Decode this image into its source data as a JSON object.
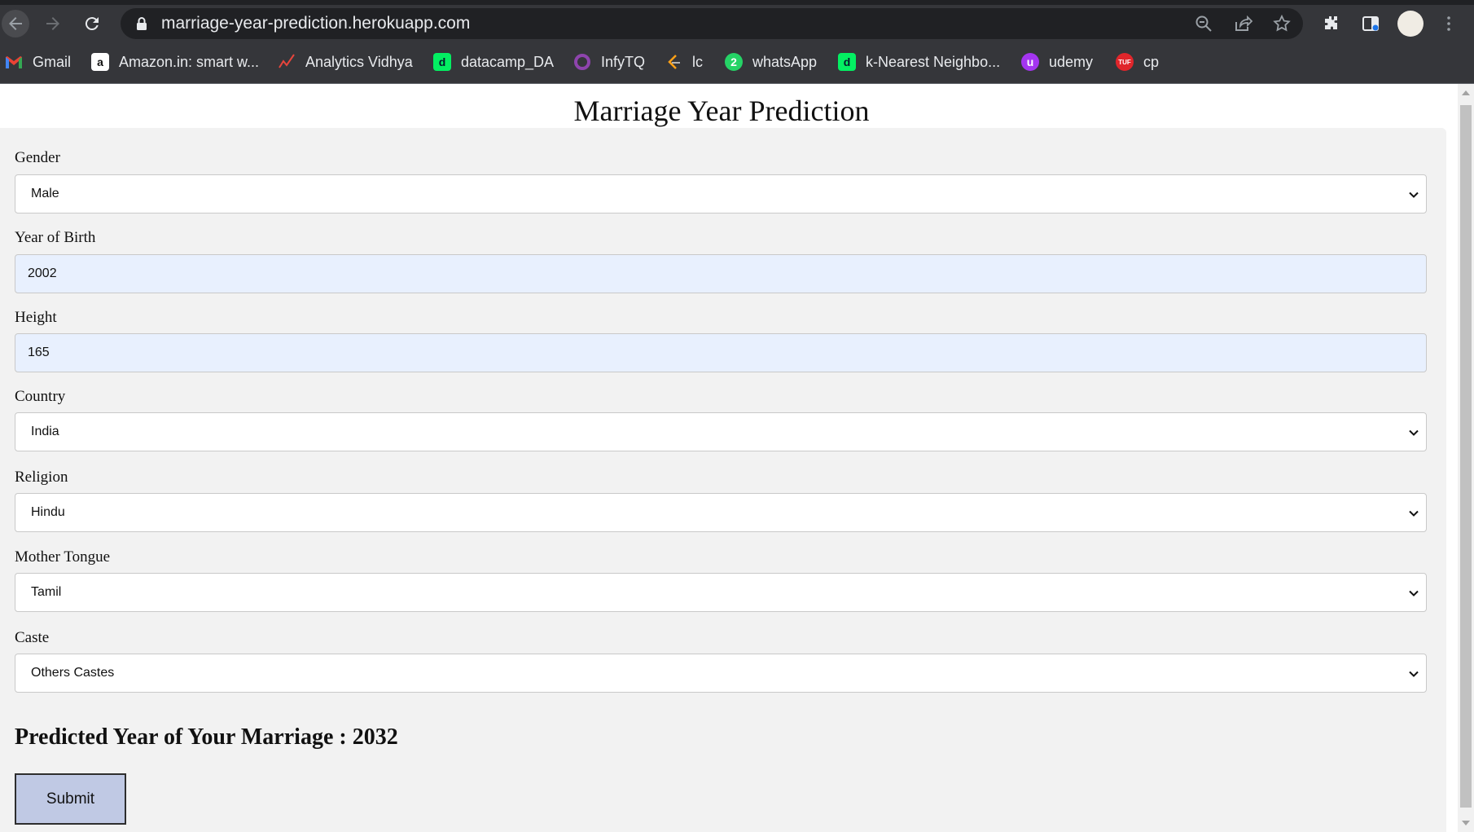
{
  "browser": {
    "url": "marriage-year-prediction.herokuapp.com",
    "bookmarks": [
      {
        "label": "Gmail",
        "icon": "gmail-icon",
        "color": "#ea4335"
      },
      {
        "label": "Amazon.in: smart w...",
        "icon": "amazon-icon",
        "color": "#ffffff"
      },
      {
        "label": "Analytics Vidhya",
        "icon": "analytics-vidhya-icon",
        "color": "#e8453c"
      },
      {
        "label": "datacamp_DA",
        "icon": "datacamp-icon",
        "color": "#03ef62"
      },
      {
        "label": "InfyTQ",
        "icon": "infytq-icon",
        "color": "#8e44ad"
      },
      {
        "label": "lc",
        "icon": "leetcode-icon",
        "color": "#ffa116"
      },
      {
        "label": "whatsApp",
        "icon": "whatsapp-icon",
        "color": "#25d366"
      },
      {
        "label": "k-Nearest Neighbo...",
        "icon": "datacamp-icon",
        "color": "#03ef62"
      },
      {
        "label": "udemy",
        "icon": "udemy-icon",
        "color": "#a435f0"
      },
      {
        "label": "cp",
        "icon": "tuf-icon",
        "color": "#e0262b"
      }
    ]
  },
  "page": {
    "title": "Marriage Year Prediction",
    "fields": {
      "gender": {
        "label": "Gender",
        "value": "Male"
      },
      "year_of_birth": {
        "label": "Year of Birth",
        "value": "2002"
      },
      "height": {
        "label": "Height",
        "value": "165"
      },
      "country": {
        "label": "Country",
        "value": "India"
      },
      "religion": {
        "label": "Religion",
        "value": "Hindu"
      },
      "mother_tongue": {
        "label": "Mother Tongue",
        "value": "Tamil"
      },
      "caste": {
        "label": "Caste",
        "value": "Others Castes"
      }
    },
    "result_text": "Predicted Year of Your Marriage : 2032",
    "submit_label": "Submit"
  }
}
